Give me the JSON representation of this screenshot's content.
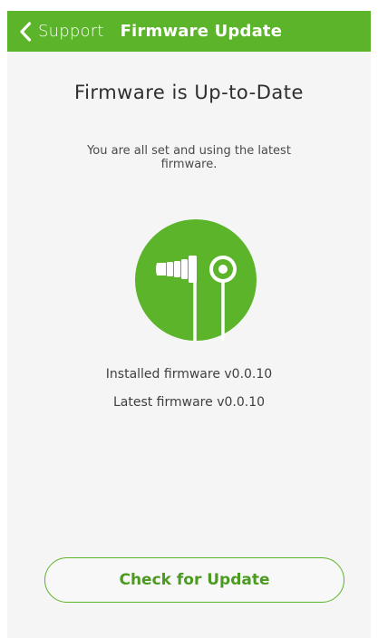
{
  "header": {
    "back_label": "Support",
    "title": "Firmware Update"
  },
  "main": {
    "heading": "Firmware is Up-to-Date",
    "description": "You are all set and using the latest firmware.",
    "illustration_icon": "earphone-icon",
    "installed_firmware": "Installed firmware v0.0.10",
    "latest_firmware": "Latest firmware v0.0.10",
    "check_button_label": "Check for Update"
  },
  "colors": {
    "accent": "#5cb42a",
    "background": "#f5f5f5"
  }
}
